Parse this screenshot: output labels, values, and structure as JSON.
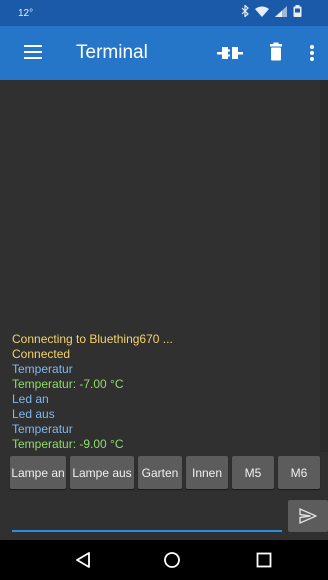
{
  "status_bar": {
    "time": "12°"
  },
  "app_bar": {
    "title": "Terminal",
    "menu_icon": "hamburger-menu-icon",
    "actions": [
      "connect-plug-icon",
      "trash-icon",
      "overflow-menu-icon"
    ]
  },
  "terminal": {
    "lines": [
      {
        "text": "Connecting to Bluething670 ...",
        "color": "#f1d36b"
      },
      {
        "text": "Connected",
        "color": "#f1d36b"
      },
      {
        "text": "Temperatur",
        "color": "#7fb8ef"
      },
      {
        "text": "Temperatur: -7.00 °C",
        "color": "#8fdc6a"
      },
      {
        "text": "Led an",
        "color": "#7fb8ef"
      },
      {
        "text": "Led aus",
        "color": "#7fb8ef"
      },
      {
        "text": "Temperatur",
        "color": "#7fb8ef"
      },
      {
        "text": "Temperatur: -9.00 °C",
        "color": "#8fdc6a"
      }
    ]
  },
  "macros": [
    {
      "label": "Lampe an"
    },
    {
      "label": "Lampe aus"
    },
    {
      "label": "Garten"
    },
    {
      "label": "Innen"
    },
    {
      "label": "M5"
    },
    {
      "label": "M6"
    }
  ],
  "input": {
    "value": "",
    "send_icon": "send-icon"
  },
  "colors": {
    "accent": "#2576c8",
    "status_bar": "#1a5aa8",
    "background": "#303030",
    "button": "#5c5c5c"
  }
}
